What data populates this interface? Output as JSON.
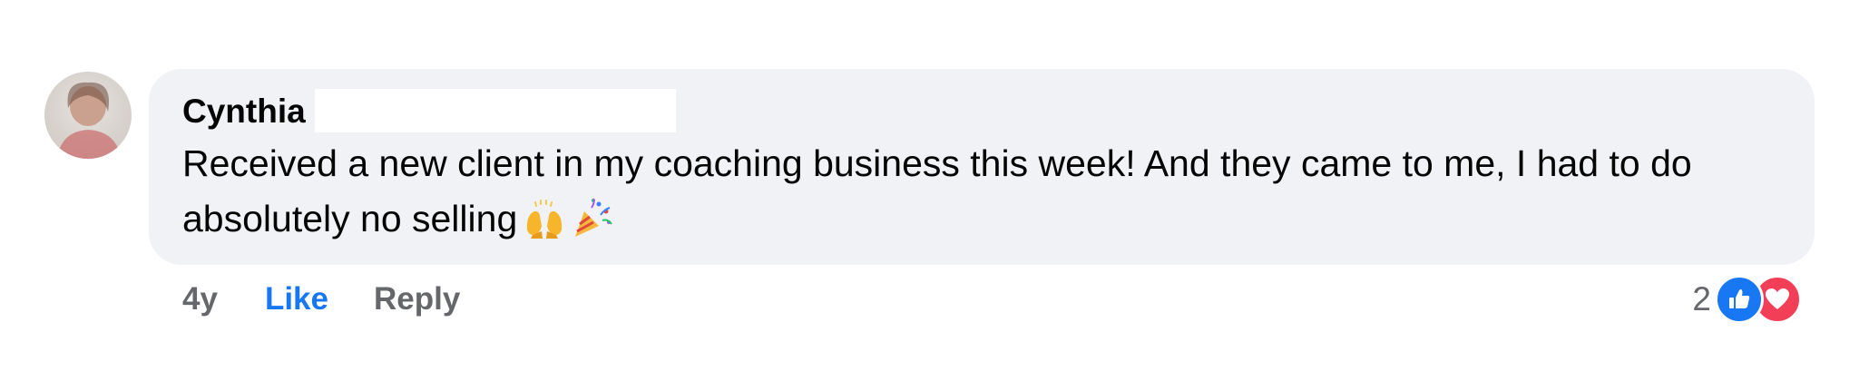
{
  "comment": {
    "author": "Cynthia",
    "text": "Received a new client in my coaching business this week! And they came to me, I had to do absolutely no selling",
    "emojis": [
      "raising-hands-emoji",
      "party-popper-emoji"
    ],
    "time": "4y",
    "like_label": "Like",
    "reply_label": "Reply",
    "reaction_count": "2",
    "reactions": [
      "like",
      "love"
    ]
  },
  "colors": {
    "bubble": "#f0f2f5",
    "like_active": "#1877f2",
    "love": "#f33e58",
    "meta_text": "#65676b"
  }
}
